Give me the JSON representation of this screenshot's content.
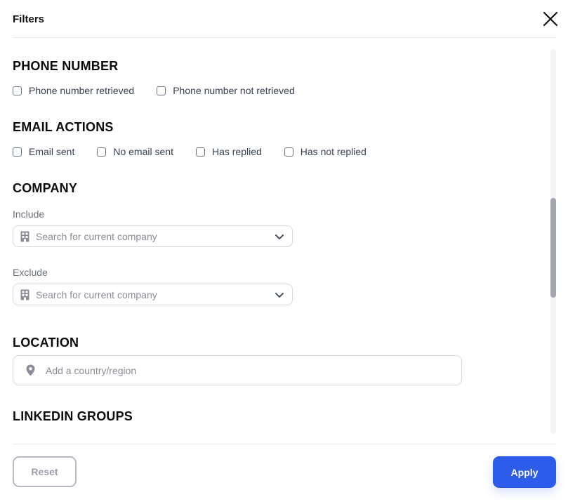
{
  "header": {
    "title": "Filters"
  },
  "sections": {
    "phone": {
      "title": "PHONE NUMBER",
      "options": [
        "Phone number retrieved",
        "Phone number not retrieved"
      ]
    },
    "email": {
      "title": "EMAIL ACTIONS",
      "options": [
        "Email sent",
        "No email sent",
        "Has replied",
        "Has not replied"
      ]
    },
    "company": {
      "title": "COMPANY",
      "include_label": "Include",
      "include_placeholder": "Search for current company",
      "exclude_label": "Exclude",
      "exclude_placeholder": "Search for current company"
    },
    "location": {
      "title": "LOCATION",
      "placeholder": "Add a country/region"
    },
    "linkedin_groups": {
      "title": "LINKEDIN GROUPS"
    }
  },
  "footer": {
    "reset_label": "Reset",
    "apply_label": "Apply"
  },
  "colors": {
    "accent": "#2d5bea",
    "border": "#d6d8de",
    "icon": "#8a8d97"
  }
}
